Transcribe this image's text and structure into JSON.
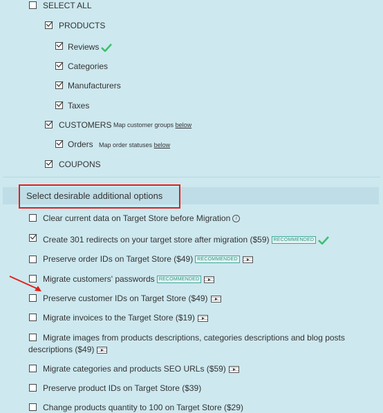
{
  "entities": {
    "select_all": "SELECT ALL",
    "products": "PRODUCTS",
    "reviews": "Reviews",
    "categories": "Categories",
    "manufacturers": "Manufacturers",
    "taxes": "Taxes",
    "customers": "CUSTOMERS",
    "customers_note": "Map customer groups",
    "customers_note_link": "below",
    "orders": "Orders",
    "orders_note": "Map order statuses",
    "orders_note_link": "below",
    "coupons": "COUPONS"
  },
  "options": {
    "section_title": "Select desirable additional options",
    "recommended_label": "RECOMMENDED",
    "items": [
      {
        "label": "Clear current data on Target Store before Migration",
        "checked": false
      },
      {
        "label": "Create 301 redirects on your target store after migration ($59)",
        "checked": true
      },
      {
        "label": "Preserve order IDs on Target Store ($49)",
        "checked": false
      },
      {
        "label": "Migrate customers' passwords",
        "checked": false
      },
      {
        "label": "Preserve customer IDs on Target Store ($49)",
        "checked": false
      },
      {
        "label": "Migrate invoices to the Target Store ($19)",
        "checked": false
      },
      {
        "label": "Migrate images from products descriptions, categories descriptions and blog posts",
        "label_line2": "descriptions ($49)",
        "checked": false
      },
      {
        "label": "Migrate categories and products SEO URLs ($59)",
        "checked": false
      },
      {
        "label": "Preserve product IDs on Target Store ($39)",
        "checked": false
      },
      {
        "label": "Change products quantity to 100 on Target Store ($29)",
        "checked": false
      }
    ]
  },
  "colors": {
    "background": "#cde8ef",
    "section_band": "#bfdde6",
    "highlight_box": "#e0201c",
    "arrow": "#e0201c",
    "check_green": "#3fbf6f",
    "recommended_border": "#3aa89a"
  },
  "icons": [
    "green-check-icon",
    "info-icon",
    "video-icon",
    "red-arrow-icon",
    "checkbox-icon"
  ]
}
